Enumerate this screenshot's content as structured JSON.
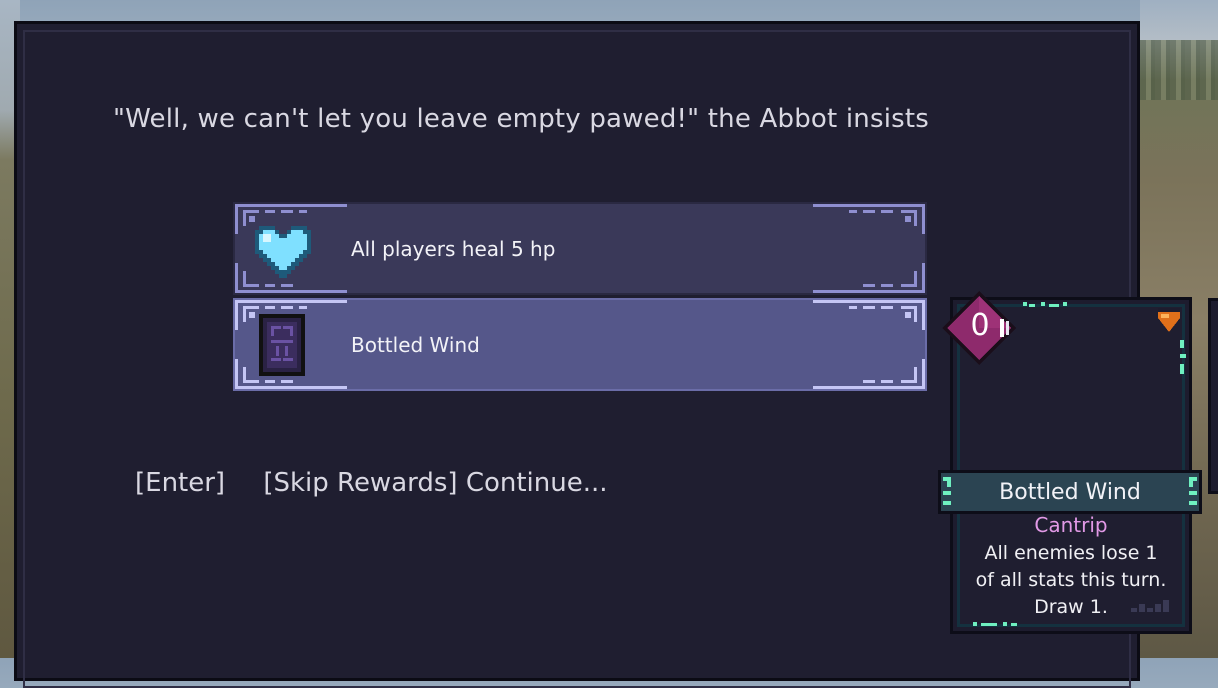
{
  "dialog": {
    "text": "\"Well, we can't let you leave empty pawed!\" the Abbot insists"
  },
  "rewards": [
    {
      "label": "All players heal 5 hp",
      "icon": "heart-icon",
      "selected": false
    },
    {
      "label": "Bottled Wind",
      "icon": "bottle-icon",
      "selected": true
    }
  ],
  "continue": {
    "key": "[Enter]",
    "label": "[Skip Rewards] Continue..."
  },
  "card": {
    "cost": "0",
    "title": "Bottled Wind",
    "type": "Cantrip",
    "description": [
      "All enemies lose 1",
      "of all stats this turn.",
      "Draw 1."
    ]
  },
  "colors": {
    "dialog_bg": "#1f1e30",
    "option_bg": "#3a3959",
    "option_selected_bg": "#55578a",
    "heart": "#7fe0ff",
    "cost_gem": "#8e2a6c",
    "card_type": "#e199e6",
    "card_accent": "#6ff0c0"
  }
}
